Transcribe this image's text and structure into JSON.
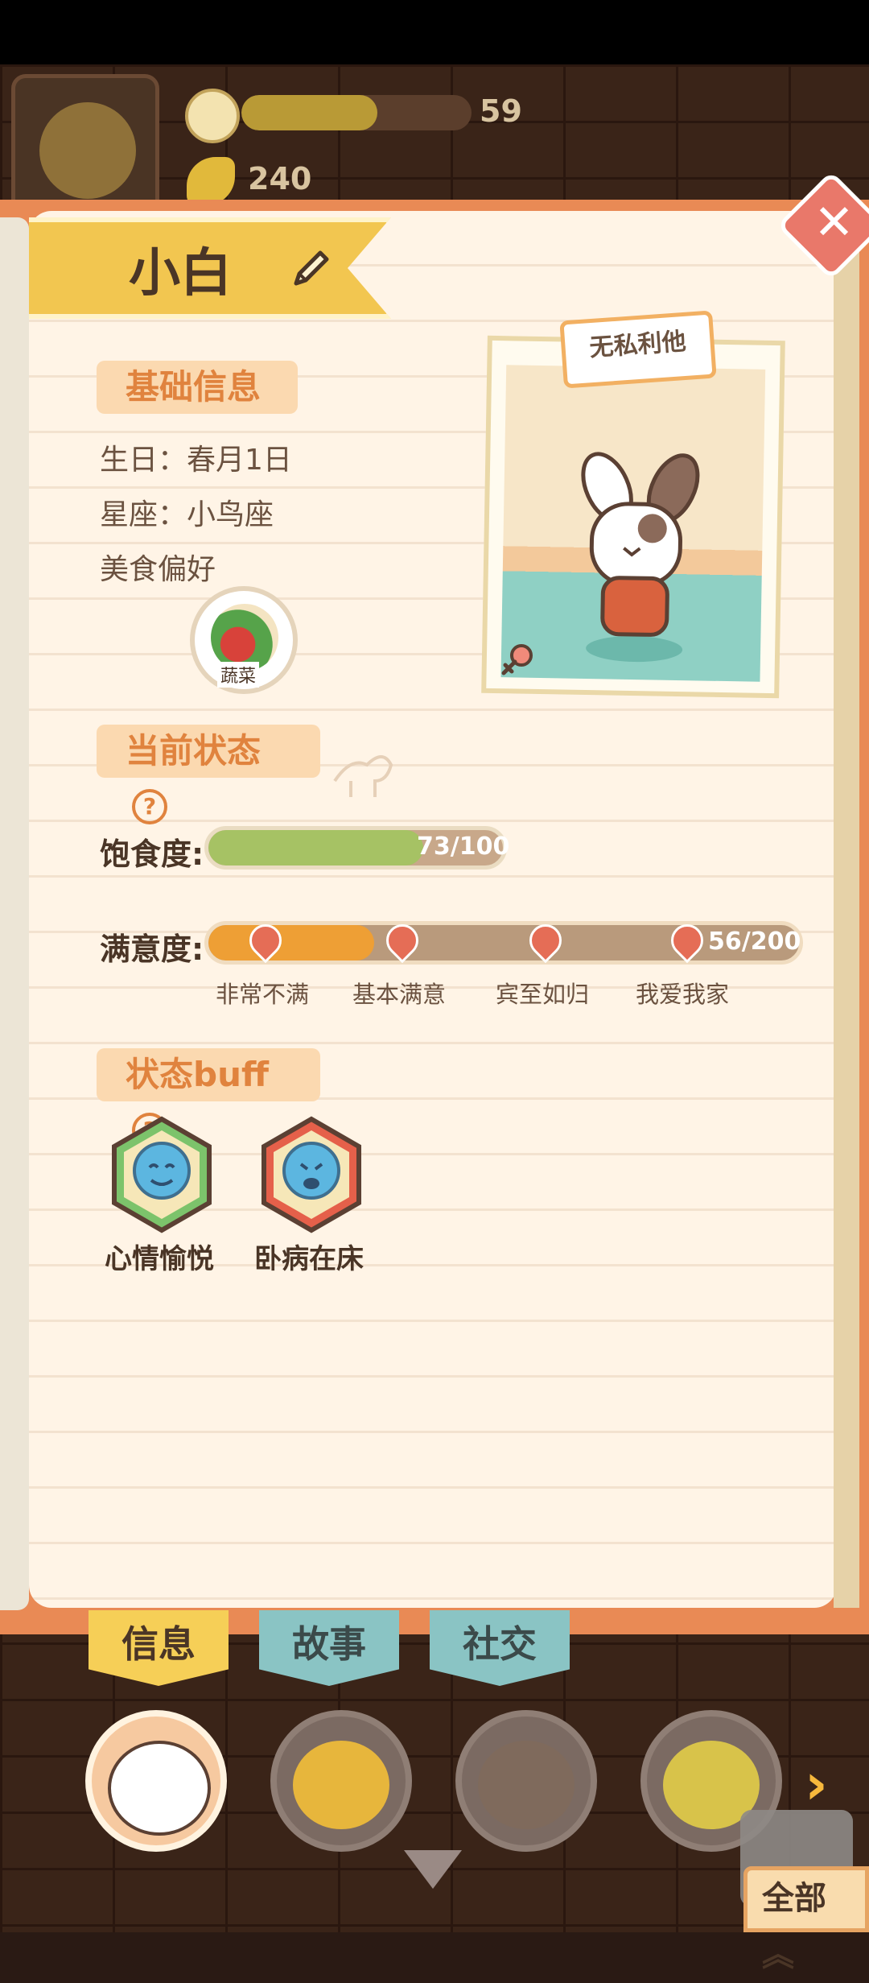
{
  "header": {
    "flower_value": "59",
    "flower_progress": 0.59,
    "banana_value": "240"
  },
  "profile": {
    "name": "小白",
    "trait": "无私利他",
    "basic_info": {
      "title": "基础信息",
      "birthday": "生日：春月1日",
      "constellation": "星座：小鸟座",
      "food_pref_label": "美食偏好",
      "food_pref": "蔬菜"
    }
  },
  "status": {
    "title": "当前状态",
    "help": "?",
    "hunger_label": "饱食度:",
    "hunger_text": "73/100",
    "hunger_value": 73,
    "hunger_max": 100,
    "satisfaction_label": "满意度:",
    "satisfaction_text": "56/200",
    "satisfaction_value": 56,
    "satisfaction_max": 200,
    "levels": [
      "非常不满",
      "基本满意",
      "宾至如归",
      "我爱我家"
    ]
  },
  "buffs": {
    "title": "状态buff",
    "help": "?",
    "items": [
      {
        "label": "心情愉悦",
        "color": "#7cc36b"
      },
      {
        "label": "卧病在床",
        "color": "#e5604a"
      }
    ]
  },
  "tabs": [
    "信息",
    "故事",
    "社交"
  ],
  "all_button": "全部",
  "colors": {
    "panel": "#fff4e6",
    "accent_orange": "#e98a55",
    "hunger_fill": "#a6c264",
    "satisfaction_fill": "#ee9f35"
  }
}
